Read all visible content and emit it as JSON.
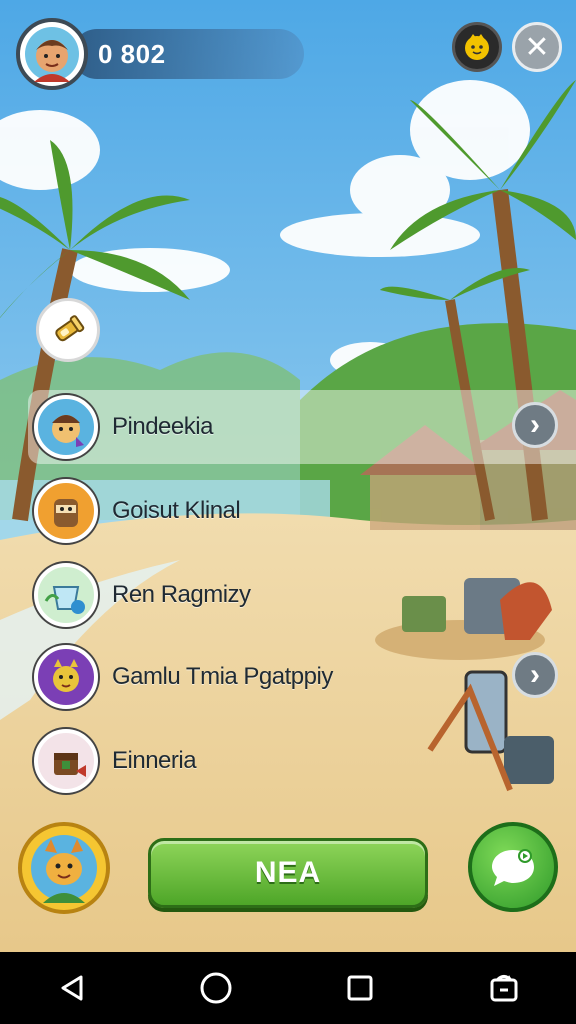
{
  "hud": {
    "score": "0 802",
    "avatar_icon": "player-avatar-icon",
    "coin_icon": "gold-character-icon",
    "close_icon": "close-icon",
    "close_glyph": "✕"
  },
  "floating_icon": "flashlight-icon",
  "menu": {
    "items": [
      {
        "label": "Pindeekia",
        "icon": "character-portrait-icon",
        "ring": "#3aa0d8"
      },
      {
        "label": "Goisut Klinal",
        "icon": "drum-character-icon",
        "ring": "#f0a030"
      },
      {
        "label": "Ren Ragmizy",
        "icon": "cup-character-icon",
        "ring": "#43a047"
      },
      {
        "label": "Gamlu Tmia Pgatppiy",
        "icon": "cat-character-icon",
        "ring": "#7b3fb5"
      },
      {
        "label": "Einneria",
        "icon": "chest-character-icon",
        "ring": "#c0392b"
      }
    ],
    "arrow_glyph": "›"
  },
  "bottom": {
    "primary_label": "NEA",
    "character_icon": "fox-character-icon",
    "chat_icon": "chat-bubble-icon"
  },
  "colors": {
    "sky": "#5fb4e8",
    "sand": "#edd4a0",
    "primary_green": "#5cb52f",
    "palm_green": "#4f9a2e"
  },
  "navbar": {
    "back_icon": "back-triangle-icon",
    "home_icon": "home-circle-icon",
    "recents_icon": "recents-square-icon",
    "rotate_icon": "rotate-screen-icon"
  }
}
